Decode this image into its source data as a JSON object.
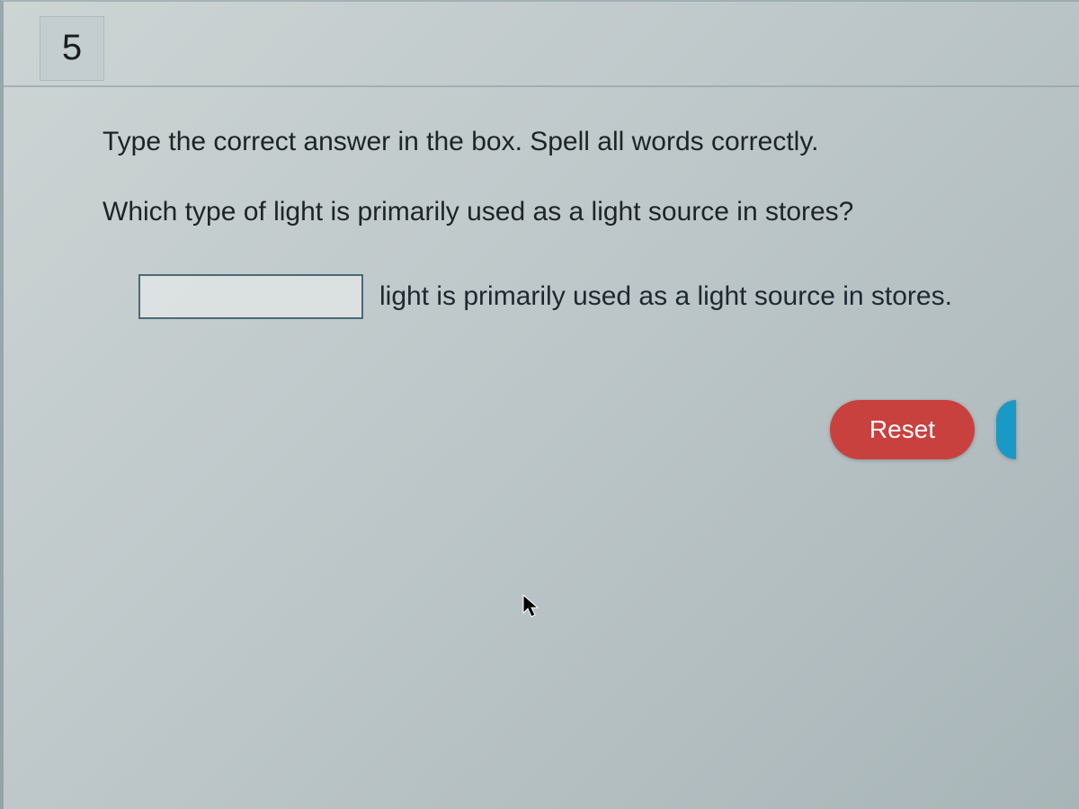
{
  "header": {
    "question_number": "5"
  },
  "content": {
    "instruction": "Type the correct answer in the box. Spell all words correctly.",
    "prompt": "Which type of light is primarily used as a light source in stores?",
    "answer_value": "",
    "answer_suffix": "light is primarily used as a light source in stores."
  },
  "buttons": {
    "reset_label": "Reset"
  }
}
